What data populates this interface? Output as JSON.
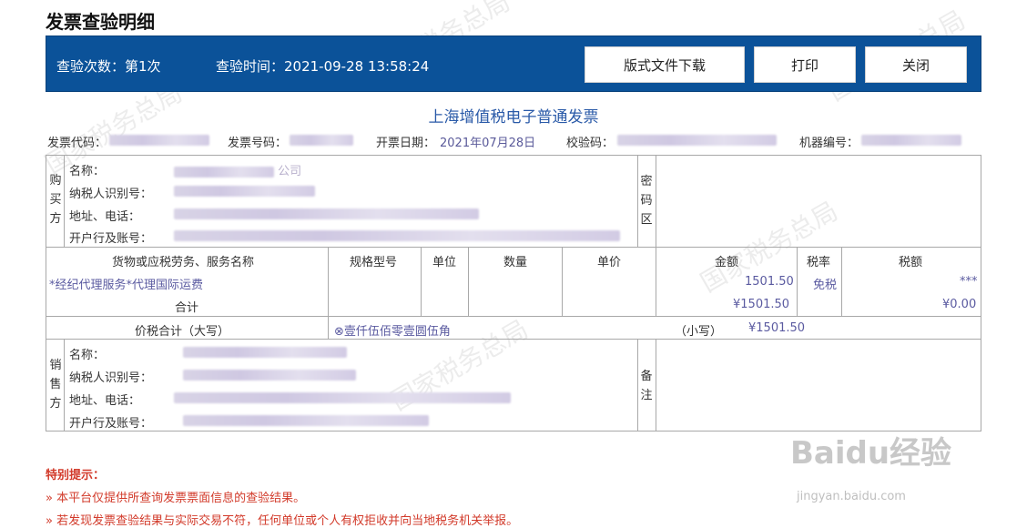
{
  "page": {
    "title": "发票查验明细"
  },
  "info_bar": {
    "check_count": "查验次数：第1次",
    "check_time": "查验时间：2021-09-28 13:58:24",
    "buttons": {
      "download": "版式文件下载",
      "print": "打印",
      "close": "关闭"
    }
  },
  "invoice": {
    "title": "上海增值税电子普通发票",
    "header": {
      "code_label": "发票代码：",
      "number_label": "发票号码：",
      "date_label": "开票日期：",
      "date_value": "2021年07月28日",
      "check_code_label": "校验码：",
      "machine_label": "机器编号："
    },
    "buyer": {
      "section_label": "购买方",
      "name_label": "名称：",
      "name_tail": "公司",
      "tax_id_label": "纳税人识别号：",
      "address_label": "地址、电话：",
      "bank_label": "开户行及账号："
    },
    "cipher_label": "密码区",
    "items_header": {
      "goods": "货物或应税劳务、服务名称",
      "spec": "规格型号",
      "unit": "单位",
      "qty": "数量",
      "price": "单价",
      "amount": "金额",
      "tax_rate": "税率",
      "tax": "税额"
    },
    "items": [
      {
        "goods": "*经纪代理服务*代理国际运费",
        "amount": "1501.50",
        "tax_rate": "免税",
        "tax": "***"
      }
    ],
    "subtotal": {
      "label": "合计",
      "amount": "¥1501.50",
      "tax": "¥0.00"
    },
    "total": {
      "label": "价税合计（大写）",
      "uppercase": "⊗壹仟伍佰零壹圆伍角",
      "small_label": "（小写）",
      "small_value": "¥1501.50"
    },
    "seller": {
      "section_label": "销售方",
      "name_label": "名称：",
      "tax_id_label": "纳税人识别号：",
      "address_label": "地址、电话：",
      "bank_label": "开户行及账号："
    },
    "remark_label": "备注"
  },
  "notice": {
    "title": "特别提示：",
    "items": [
      "» 本平台仅提供所查询发票票面信息的查验结果。",
      "» 若发现发票查验结果与实际交易不符，任何单位或个人有权拒收并向当地税务机关举报。"
    ]
  },
  "watermark": {
    "text": "国家税务总局"
  },
  "branding": {
    "logo": "Baidu经验",
    "sub": "jingyan.baidu.com"
  }
}
